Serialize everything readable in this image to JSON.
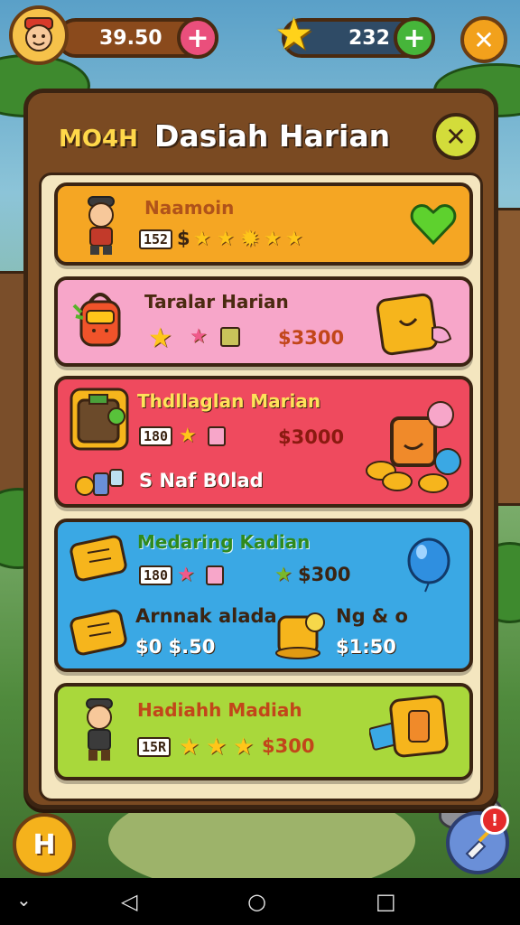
{
  "topbar": {
    "coins_value": "39.50",
    "coins_plus": "+",
    "gems_value": "232",
    "gems_plus": "+",
    "close": "✕"
  },
  "panel": {
    "badge": "MO4H",
    "title": "Dasiah Harian",
    "close": "✕"
  },
  "cards": [
    {
      "title": "Naamoin",
      "tag": "152",
      "value": "$",
      "colors": {
        "bg": "#f5a623"
      }
    },
    {
      "title": "Taralar Harian",
      "value": "$3300"
    },
    {
      "title": "Thdllaglan Marian",
      "tag": "180",
      "value": "$3000",
      "sub": "S Naf B0lad"
    },
    {
      "title": "Medaring Kadian",
      "tag": "180",
      "value": "$300",
      "sub_left_title": "Arnnak alada",
      "sub_left_value": "$0 $.50",
      "sub_right_title": "Ng & o",
      "sub_right_value": "$1:50"
    },
    {
      "title": "Hadiahh Madiah",
      "tag": "15R",
      "value": "$300"
    }
  ],
  "floating": {
    "left_label": "H",
    "notif_count": "!"
  },
  "colors": {
    "panel": "#7a4a22",
    "card_orange": "#f5a623",
    "card_pink": "#f7a6c9",
    "card_red": "#ef4a5e",
    "card_blue": "#3aa8e4",
    "card_green": "#a9d83b"
  },
  "icons": {
    "nav_back": "back-triangle-icon",
    "nav_home": "home-circle-icon",
    "nav_recent": "recent-square-icon",
    "nav_down": "chevron-down-icon"
  }
}
